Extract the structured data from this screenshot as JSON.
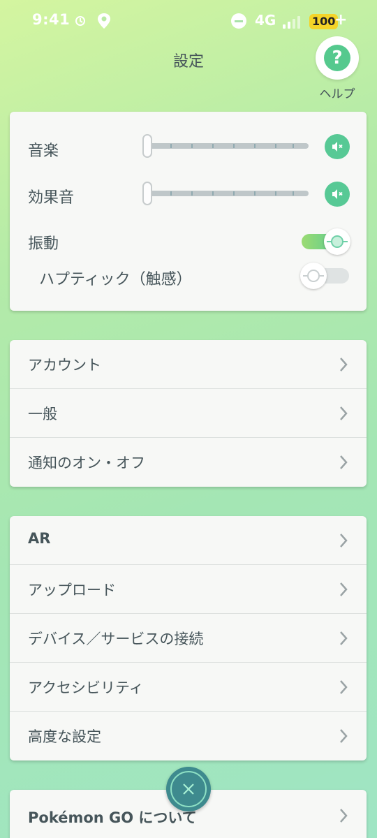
{
  "status_bar": {
    "time": "9:41",
    "network": "4G",
    "battery": "100",
    "battery_charging_symbol": "+"
  },
  "header": {
    "title": "設定",
    "help_symbol": "?",
    "help_label": "ヘルプ"
  },
  "audio": {
    "music_label": "音楽",
    "music_level": 0,
    "effects_label": "効果音",
    "effects_level": 0,
    "vibration_label": "振動",
    "vibration_on": true,
    "haptic_label": "ハプティック（触感）",
    "haptic_on": false
  },
  "account_menu": {
    "items": [
      {
        "label": "アカウント"
      },
      {
        "label": "一般"
      },
      {
        "label": "通知のオン・オフ"
      }
    ]
  },
  "misc_menu": {
    "items": [
      {
        "label": "AR"
      },
      {
        "label": "アップロード"
      },
      {
        "label": "デバイス／サービスの接続"
      },
      {
        "label": "アクセシビリティ"
      },
      {
        "label": "高度な設定"
      }
    ]
  },
  "about_menu": {
    "items": [
      {
        "label": "Pokémon GO について"
      }
    ]
  },
  "colors": {
    "accent": "#55c98e",
    "close_button": "#3e8a8e"
  },
  "icons": [
    "location-icon",
    "dnd-icon",
    "signal-icon",
    "battery-icon",
    "help-icon",
    "mute-icon",
    "chevron-right-icon",
    "close-icon"
  ]
}
